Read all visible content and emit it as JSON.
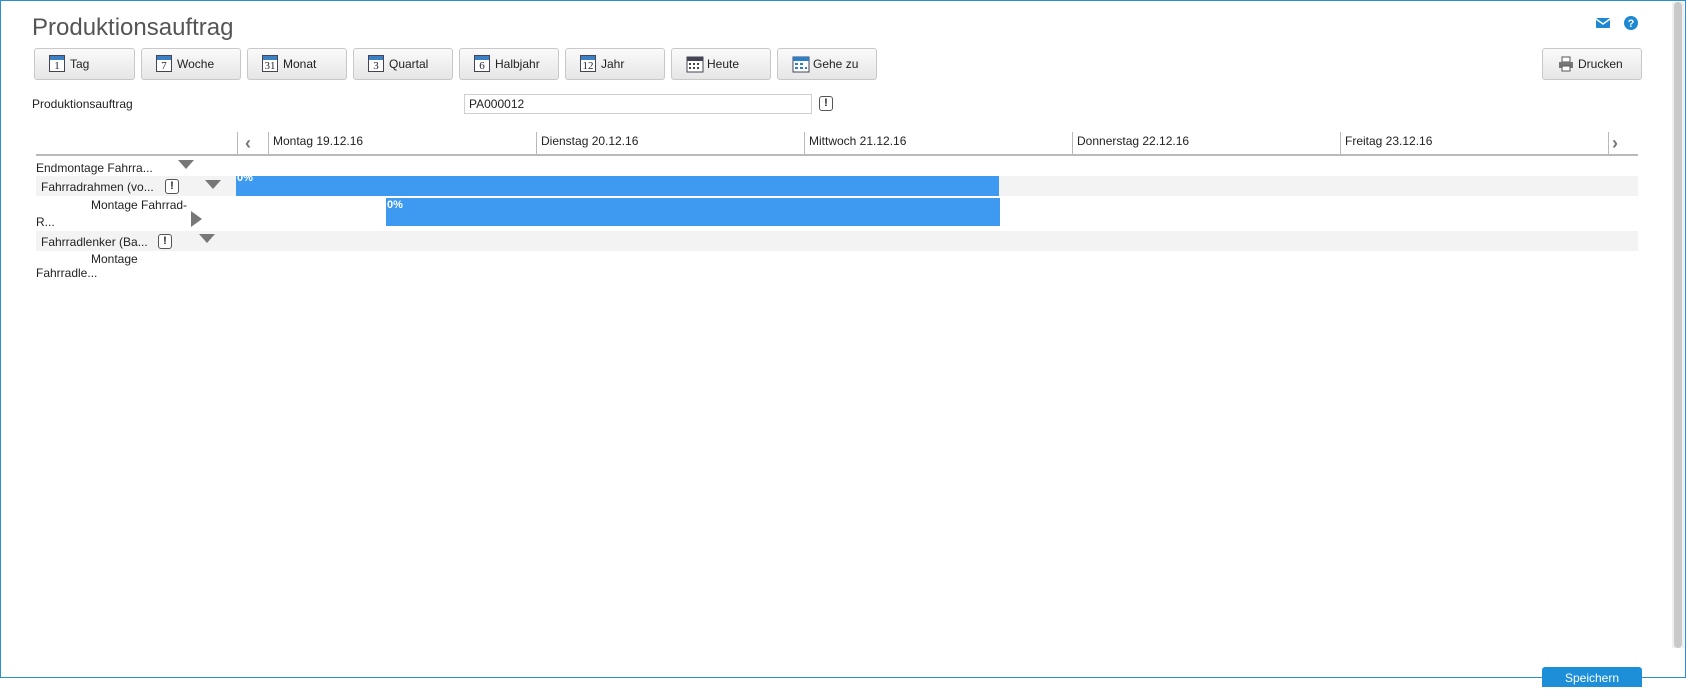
{
  "page": {
    "title": "Produktionsauftrag"
  },
  "toolbar": {
    "tag": "Tag",
    "woche": "Woche",
    "monat": "Monat",
    "quartal": "Quartal",
    "halbjahr": "Halbjahr",
    "jahr": "Jahr",
    "heute": "Heute",
    "gehe_zu": "Gehe zu",
    "drucken": "Drucken",
    "icons": {
      "tag": "1",
      "woche": "7",
      "monat": "31",
      "quartal": "3",
      "halbjahr": "6",
      "jahr": "12"
    }
  },
  "filter": {
    "label": "Produktionsauftrag",
    "value": "PA000012",
    "info_symbol": "!"
  },
  "timeline": {
    "days": [
      "Montag 19.12.16",
      "Dienstag 20.12.16",
      "Mittwoch 21.12.16",
      "Donnerstag 22.12.16",
      "Freitag 23.12.16"
    ]
  },
  "rows": {
    "r0": {
      "label": "Endmontage Fahrra..."
    },
    "r1": {
      "label": "Fahrradrahmen (vo...",
      "info": "!",
      "bar_label": "0%",
      "progress_percent": 0
    },
    "r2": {
      "label_line1": "Montage Fahrrad-",
      "label_line2": "R...",
      "bar_label": "0%",
      "progress_percent": 0
    },
    "r3": {
      "label": "Fahrradlenker (Ba...",
      "info": "!"
    },
    "r4": {
      "label_line1": "Montage",
      "label_line2": "Fahrradle..."
    }
  },
  "footer": {
    "save_label": "Speichern"
  },
  "colors": {
    "accent": "#3d9af0",
    "frame": "#2a8fd0",
    "save_button": "#1c8fd8"
  }
}
